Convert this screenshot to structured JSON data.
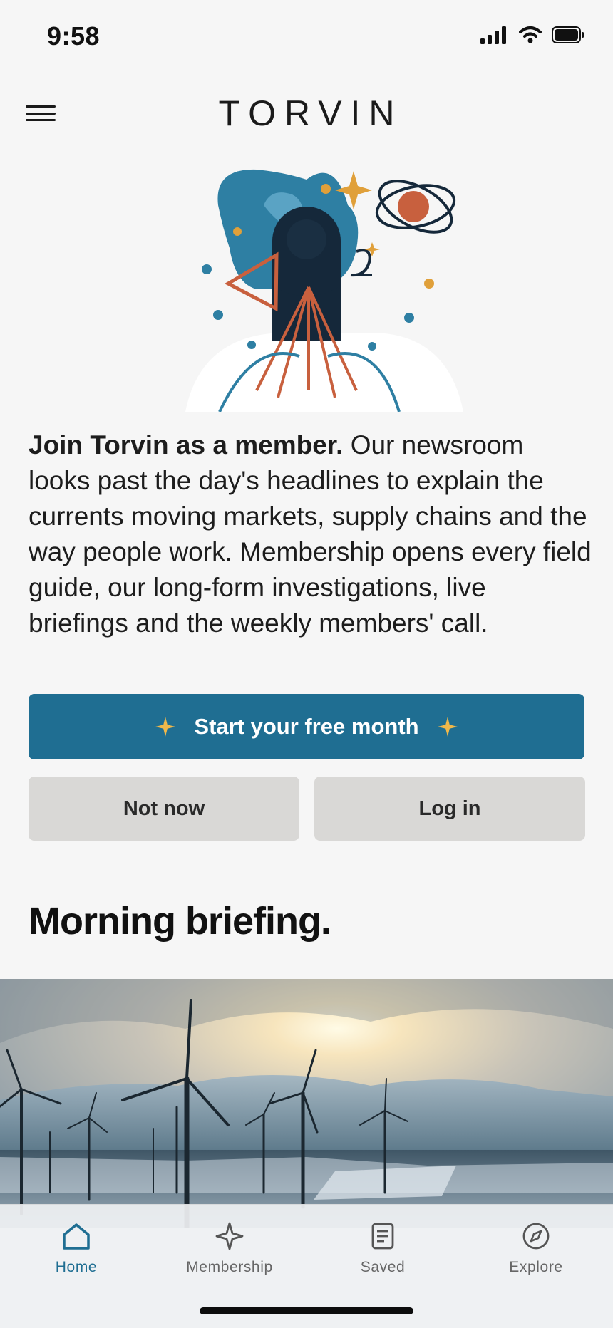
{
  "status_bar": {
    "time": "9:58"
  },
  "header": {
    "brand": "TORVIN",
    "menu_icon": "hamburger-menu-icon"
  },
  "intro": {
    "lead": "Join Torvin as a member.",
    "body": " Our newsroom looks past the day's headlines to explain the currents moving markets, supply chains and the way people work. Membership opens every field guide, our long-form investigations, live briefings and the weekly members' call."
  },
  "actions": {
    "primary_label": "Start your free month",
    "not_now_label": "Not now",
    "login_label": "Log in"
  },
  "section": {
    "title": "Morning briefing."
  },
  "tabs": [
    {
      "label": "Home",
      "icon": "home-icon",
      "active": true
    },
    {
      "label": "Membership",
      "icon": "sparkle-icon",
      "active": false
    },
    {
      "label": "Saved",
      "icon": "document-icon",
      "active": false
    },
    {
      "label": "Explore",
      "icon": "compass-icon",
      "active": false
    }
  ],
  "colors": {
    "accent": "#1f6e92",
    "secondary_button": "#d9d8d6",
    "background": "#f6f6f6",
    "star": "#f0b84a",
    "rust": "#c8603e"
  }
}
